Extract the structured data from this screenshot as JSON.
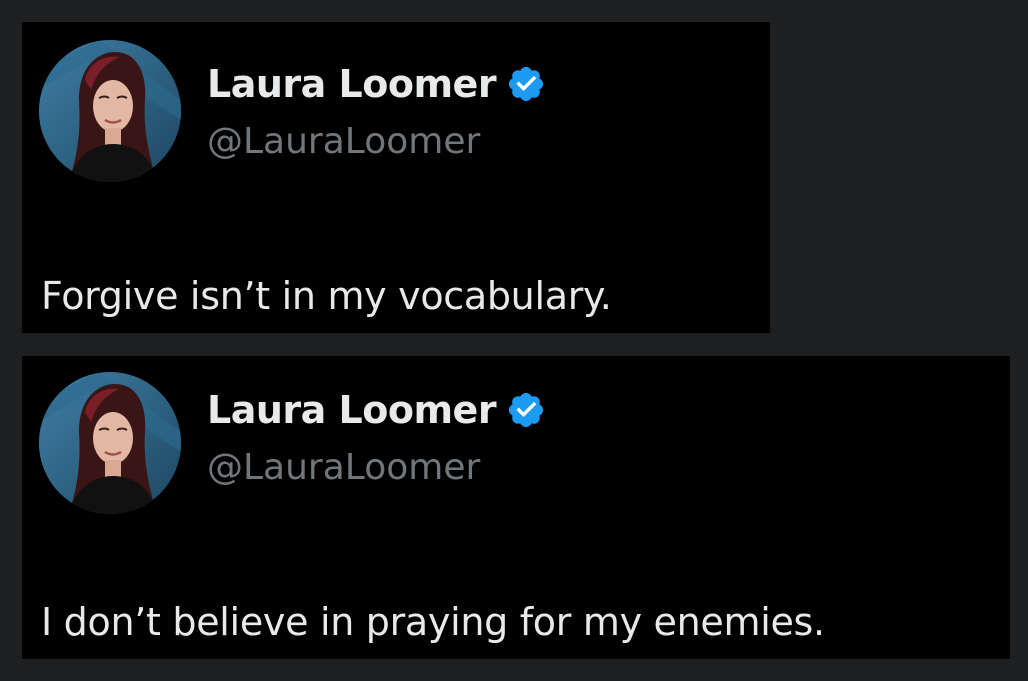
{
  "tweets": [
    {
      "display_name": "Laura Loomer",
      "handle": "@LauraLoomer",
      "text": "Forgive isn’t in my vocabulary.",
      "verified": true,
      "verified_icon": "verified-badge-icon",
      "avatar": "profile-photo"
    },
    {
      "display_name": "Laura Loomer",
      "handle": "@LauraLoomer",
      "text": "I don’t believe in praying for my enemies.",
      "verified": true,
      "verified_icon": "verified-badge-icon",
      "avatar": "profile-photo"
    }
  ],
  "colors": {
    "background": "#1e1f21",
    "card": "#000000",
    "name_text": "#e7e9ea",
    "handle_text": "#71767b",
    "verified_blue": "#1d9bf0"
  }
}
